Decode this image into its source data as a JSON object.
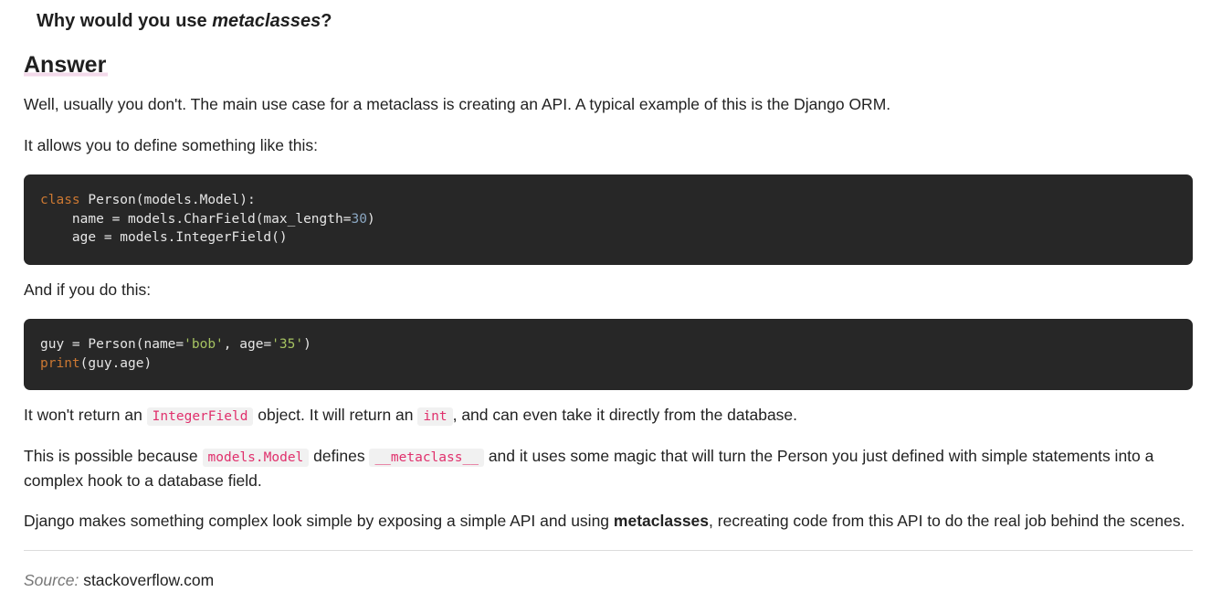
{
  "question": {
    "prefix": "Why would you use ",
    "emphasis": "metaclasses",
    "suffix": "?"
  },
  "answer_heading": "Answer",
  "paragraphs": {
    "p1": "Well, usually you don't. The main use case for a metaclass is creating an API. A typical example of this is the Django ORM.",
    "p2": "It allows you to define something like this:",
    "p3": "And if you do this:",
    "p4": {
      "a": "It won't return an ",
      "code1": "IntegerField",
      "b": " object. It will return an ",
      "code2": "int",
      "c": ", and can even take it directly from the database."
    },
    "p5": {
      "a": "This is possible because ",
      "code1": "models.Model",
      "b": " defines ",
      "code2": "__metaclass__",
      "c": " and it uses some magic that will turn the Person you just defined with simple statements into a complex hook to a database field."
    },
    "p6": {
      "a": "Django makes something complex look simple by exposing a simple API and using ",
      "strong": "metaclasses",
      "b": ", recreating code from this API to do the real job behind the scenes."
    }
  },
  "code_block_1": {
    "line1_kw": "class",
    "line1_rest": " Person(models.Model):",
    "line2_a": "    name = models.CharField(max_length=",
    "line2_num": "30",
    "line2_b": ")",
    "line3": "    age = models.IntegerField()"
  },
  "code_block_2": {
    "line1_a": "guy = Person(name=",
    "line1_str1": "'bob'",
    "line1_b": ", age=",
    "line1_str2": "'35'",
    "line1_c": ")",
    "line2_kw": "print",
    "line2_rest": "(guy.age)"
  },
  "source": {
    "label": "Source:",
    "value": "stackoverflow.com"
  },
  "colors": {
    "code_bg": "#272727",
    "keyword": "#cc7832",
    "number": "#8aa6c1",
    "string": "#a5c261",
    "inline_code": "#e0306c"
  }
}
